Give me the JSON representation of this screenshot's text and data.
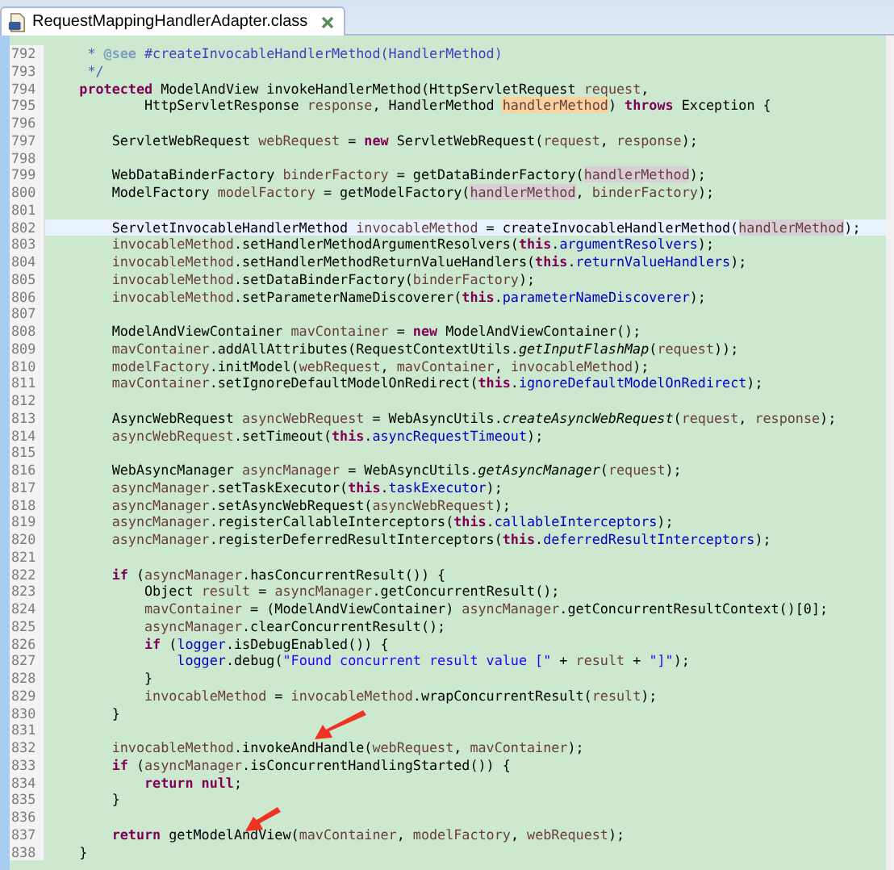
{
  "tab": {
    "title": "RequestMappingHandlerAdapter.class",
    "selected": true
  },
  "lines": [
    {
      "number": "792",
      "current": false,
      "tokens": [
        {
          "kind": "comment",
          "text": "     * "
        },
        {
          "kind": "doc-tag",
          "text": "@see"
        },
        {
          "kind": "doc-link",
          "text": " #createInvocableHandlerMethod(HandlerMethod)"
        }
      ]
    },
    {
      "number": "793",
      "current": false,
      "tokens": [
        {
          "kind": "comment",
          "text": "     */"
        }
      ]
    },
    {
      "number": "794",
      "current": false,
      "tokens": [
        {
          "kind": "keyword",
          "text": "    protected"
        },
        {
          "kind": "plain",
          "text": " ModelAndView invokeHandlerMethod(HttpServletRequest "
        },
        {
          "kind": "local",
          "text": "request"
        },
        {
          "kind": "plain",
          "text": ","
        }
      ]
    },
    {
      "number": "795",
      "current": false,
      "tokens": [
        {
          "kind": "plain",
          "text": "            HttpServletResponse "
        },
        {
          "kind": "local",
          "text": "response"
        },
        {
          "kind": "plain",
          "text": ", HandlerMethod "
        },
        {
          "kind": "occurrence-write",
          "text": "handlerMethod"
        },
        {
          "kind": "plain",
          "text": ") "
        },
        {
          "kind": "keyword",
          "text": "throws"
        },
        {
          "kind": "plain",
          "text": " Exception {"
        }
      ]
    },
    {
      "number": "796",
      "current": false
    },
    {
      "number": "797",
      "current": false,
      "tokens": [
        {
          "kind": "plain",
          "text": "        ServletWebRequest "
        },
        {
          "kind": "local",
          "text": "webRequest"
        },
        {
          "kind": "plain",
          "text": " = "
        },
        {
          "kind": "keyword",
          "text": "new"
        },
        {
          "kind": "plain",
          "text": " ServletWebRequest("
        },
        {
          "kind": "local",
          "text": "request"
        },
        {
          "kind": "plain",
          "text": ", "
        },
        {
          "kind": "local",
          "text": "response"
        },
        {
          "kind": "plain",
          "text": ");"
        }
      ]
    },
    {
      "number": "798",
      "current": false
    },
    {
      "number": "799",
      "current": false,
      "tokens": [
        {
          "kind": "plain",
          "text": "        WebDataBinderFactory "
        },
        {
          "kind": "local",
          "text": "binderFactory"
        },
        {
          "kind": "plain",
          "text": " = getDataBinderFactory("
        },
        {
          "kind": "occurrence-read",
          "text": "handlerMethod"
        },
        {
          "kind": "plain",
          "text": ");"
        }
      ]
    },
    {
      "number": "800",
      "current": false,
      "tokens": [
        {
          "kind": "plain",
          "text": "        ModelFactory "
        },
        {
          "kind": "local",
          "text": "modelFactory"
        },
        {
          "kind": "plain",
          "text": " = getModelFactory("
        },
        {
          "kind": "occurrence-read",
          "text": "handlerMethod"
        },
        {
          "kind": "plain",
          "text": ", "
        },
        {
          "kind": "local",
          "text": "binderFactory"
        },
        {
          "kind": "plain",
          "text": ");"
        }
      ]
    },
    {
      "number": "801",
      "current": false
    },
    {
      "number": "802",
      "current": true,
      "tokens": [
        {
          "kind": "plain",
          "text": "        ServletInvocableHandlerMethod "
        },
        {
          "kind": "local",
          "text": "invocableMethod"
        },
        {
          "kind": "plain",
          "text": " = createInvocableHandlerMethod("
        },
        {
          "kind": "occurrence-read",
          "text": "handlerMethod"
        },
        {
          "kind": "plain",
          "text": ");"
        }
      ]
    },
    {
      "number": "803",
      "current": false,
      "tokens": [
        {
          "kind": "local",
          "text": "        invocableMethod"
        },
        {
          "kind": "plain",
          "text": ".setHandlerMethodArgumentResolvers("
        },
        {
          "kind": "keyword",
          "text": "this"
        },
        {
          "kind": "plain",
          "text": "."
        },
        {
          "kind": "field",
          "text": "argumentResolvers"
        },
        {
          "kind": "plain",
          "text": ");"
        }
      ]
    },
    {
      "number": "804",
      "current": false,
      "tokens": [
        {
          "kind": "local",
          "text": "        invocableMethod"
        },
        {
          "kind": "plain",
          "text": ".setHandlerMethodReturnValueHandlers("
        },
        {
          "kind": "keyword",
          "text": "this"
        },
        {
          "kind": "plain",
          "text": "."
        },
        {
          "kind": "field",
          "text": "returnValueHandlers"
        },
        {
          "kind": "plain",
          "text": ");"
        }
      ]
    },
    {
      "number": "805",
      "current": false,
      "tokens": [
        {
          "kind": "local",
          "text": "        invocableMethod"
        },
        {
          "kind": "plain",
          "text": ".setDataBinderFactory("
        },
        {
          "kind": "local",
          "text": "binderFactory"
        },
        {
          "kind": "plain",
          "text": ");"
        }
      ]
    },
    {
      "number": "806",
      "current": false,
      "tokens": [
        {
          "kind": "local",
          "text": "        invocableMethod"
        },
        {
          "kind": "plain",
          "text": ".setParameterNameDiscoverer("
        },
        {
          "kind": "keyword",
          "text": "this"
        },
        {
          "kind": "plain",
          "text": "."
        },
        {
          "kind": "field",
          "text": "parameterNameDiscoverer"
        },
        {
          "kind": "plain",
          "text": ");"
        }
      ]
    },
    {
      "number": "807",
      "current": false
    },
    {
      "number": "808",
      "current": false,
      "tokens": [
        {
          "kind": "plain",
          "text": "        ModelAndViewContainer "
        },
        {
          "kind": "local",
          "text": "mavContainer"
        },
        {
          "kind": "plain",
          "text": " = "
        },
        {
          "kind": "keyword",
          "text": "new"
        },
        {
          "kind": "plain",
          "text": " ModelAndViewContainer();"
        }
      ]
    },
    {
      "number": "809",
      "current": false,
      "tokens": [
        {
          "kind": "local",
          "text": "        mavContainer"
        },
        {
          "kind": "plain",
          "text": ".addAllAttributes(RequestContextUtils."
        },
        {
          "kind": "static",
          "text": "getInputFlashMap"
        },
        {
          "kind": "plain",
          "text": "("
        },
        {
          "kind": "local",
          "text": "request"
        },
        {
          "kind": "plain",
          "text": "));"
        }
      ]
    },
    {
      "number": "810",
      "current": false,
      "tokens": [
        {
          "kind": "local",
          "text": "        modelFactory"
        },
        {
          "kind": "plain",
          "text": ".initModel("
        },
        {
          "kind": "local",
          "text": "webRequest"
        },
        {
          "kind": "plain",
          "text": ", "
        },
        {
          "kind": "local",
          "text": "mavContainer"
        },
        {
          "kind": "plain",
          "text": ", "
        },
        {
          "kind": "local",
          "text": "invocableMethod"
        },
        {
          "kind": "plain",
          "text": ");"
        }
      ]
    },
    {
      "number": "811",
      "current": false,
      "tokens": [
        {
          "kind": "local",
          "text": "        mavContainer"
        },
        {
          "kind": "plain",
          "text": ".setIgnoreDefaultModelOnRedirect("
        },
        {
          "kind": "keyword",
          "text": "this"
        },
        {
          "kind": "plain",
          "text": "."
        },
        {
          "kind": "field",
          "text": "ignoreDefaultModelOnRedirect"
        },
        {
          "kind": "plain",
          "text": ");"
        }
      ]
    },
    {
      "number": "812",
      "current": false
    },
    {
      "number": "813",
      "current": false,
      "tokens": [
        {
          "kind": "plain",
          "text": "        AsyncWebRequest "
        },
        {
          "kind": "local",
          "text": "asyncWebRequest"
        },
        {
          "kind": "plain",
          "text": " = WebAsyncUtils."
        },
        {
          "kind": "static",
          "text": "createAsyncWebRequest"
        },
        {
          "kind": "plain",
          "text": "("
        },
        {
          "kind": "local",
          "text": "request"
        },
        {
          "kind": "plain",
          "text": ", "
        },
        {
          "kind": "local",
          "text": "response"
        },
        {
          "kind": "plain",
          "text": ");"
        }
      ]
    },
    {
      "number": "814",
      "current": false,
      "tokens": [
        {
          "kind": "local",
          "text": "        asyncWebRequest"
        },
        {
          "kind": "plain",
          "text": ".setTimeout("
        },
        {
          "kind": "keyword",
          "text": "this"
        },
        {
          "kind": "plain",
          "text": "."
        },
        {
          "kind": "field",
          "text": "asyncRequestTimeout"
        },
        {
          "kind": "plain",
          "text": ");"
        }
      ]
    },
    {
      "number": "815",
      "current": false
    },
    {
      "number": "816",
      "current": false,
      "tokens": [
        {
          "kind": "plain",
          "text": "        WebAsyncManager "
        },
        {
          "kind": "local",
          "text": "asyncManager"
        },
        {
          "kind": "plain",
          "text": " = WebAsyncUtils."
        },
        {
          "kind": "static",
          "text": "getAsyncManager"
        },
        {
          "kind": "plain",
          "text": "("
        },
        {
          "kind": "local",
          "text": "request"
        },
        {
          "kind": "plain",
          "text": ");"
        }
      ]
    },
    {
      "number": "817",
      "current": false,
      "tokens": [
        {
          "kind": "local",
          "text": "        asyncManager"
        },
        {
          "kind": "plain",
          "text": ".setTaskExecutor("
        },
        {
          "kind": "keyword",
          "text": "this"
        },
        {
          "kind": "plain",
          "text": "."
        },
        {
          "kind": "field",
          "text": "taskExecutor"
        },
        {
          "kind": "plain",
          "text": ");"
        }
      ]
    },
    {
      "number": "818",
      "current": false,
      "tokens": [
        {
          "kind": "local",
          "text": "        asyncManager"
        },
        {
          "kind": "plain",
          "text": ".setAsyncWebRequest("
        },
        {
          "kind": "local",
          "text": "asyncWebRequest"
        },
        {
          "kind": "plain",
          "text": ");"
        }
      ]
    },
    {
      "number": "819",
      "current": false,
      "tokens": [
        {
          "kind": "local",
          "text": "        asyncManager"
        },
        {
          "kind": "plain",
          "text": ".registerCallableInterceptors("
        },
        {
          "kind": "keyword",
          "text": "this"
        },
        {
          "kind": "plain",
          "text": "."
        },
        {
          "kind": "field",
          "text": "callableInterceptors"
        },
        {
          "kind": "plain",
          "text": ");"
        }
      ]
    },
    {
      "number": "820",
      "current": false,
      "tokens": [
        {
          "kind": "local",
          "text": "        asyncManager"
        },
        {
          "kind": "plain",
          "text": ".registerDeferredResultInterceptors("
        },
        {
          "kind": "keyword",
          "text": "this"
        },
        {
          "kind": "plain",
          "text": "."
        },
        {
          "kind": "field",
          "text": "deferredResultInterceptors"
        },
        {
          "kind": "plain",
          "text": ");"
        }
      ]
    },
    {
      "number": "821",
      "current": false
    },
    {
      "number": "822",
      "current": false,
      "tokens": [
        {
          "kind": "keyword",
          "text": "        if"
        },
        {
          "kind": "plain",
          "text": " ("
        },
        {
          "kind": "local",
          "text": "asyncManager"
        },
        {
          "kind": "plain",
          "text": ".hasConcurrentResult()) {"
        }
      ]
    },
    {
      "number": "823",
      "current": false,
      "tokens": [
        {
          "kind": "plain",
          "text": "            Object "
        },
        {
          "kind": "local",
          "text": "result"
        },
        {
          "kind": "plain",
          "text": " = "
        },
        {
          "kind": "local",
          "text": "asyncManager"
        },
        {
          "kind": "plain",
          "text": ".getConcurrentResult();"
        }
      ]
    },
    {
      "number": "824",
      "current": false,
      "tokens": [
        {
          "kind": "local",
          "text": "            mavContainer"
        },
        {
          "kind": "plain",
          "text": " = (ModelAndViewContainer) "
        },
        {
          "kind": "local",
          "text": "asyncManager"
        },
        {
          "kind": "plain",
          "text": ".getConcurrentResultContext()[0];"
        }
      ]
    },
    {
      "number": "825",
      "current": false,
      "tokens": [
        {
          "kind": "local",
          "text": "            asyncManager"
        },
        {
          "kind": "plain",
          "text": ".clearConcurrentResult();"
        }
      ]
    },
    {
      "number": "826",
      "current": false,
      "tokens": [
        {
          "kind": "keyword",
          "text": "            if"
        },
        {
          "kind": "plain",
          "text": " ("
        },
        {
          "kind": "field",
          "text": "logger"
        },
        {
          "kind": "plain",
          "text": ".isDebugEnabled()) {"
        }
      ]
    },
    {
      "number": "827",
      "current": false,
      "tokens": [
        {
          "kind": "field",
          "text": "                logger"
        },
        {
          "kind": "plain",
          "text": ".debug("
        },
        {
          "kind": "string",
          "text": "\"Found concurrent result value [\""
        },
        {
          "kind": "plain",
          "text": " + "
        },
        {
          "kind": "local",
          "text": "result"
        },
        {
          "kind": "plain",
          "text": " + "
        },
        {
          "kind": "string",
          "text": "\"]\""
        },
        {
          "kind": "plain",
          "text": ");"
        }
      ]
    },
    {
      "number": "828",
      "current": false,
      "tokens": [
        {
          "kind": "plain",
          "text": "            }"
        }
      ]
    },
    {
      "number": "829",
      "current": false,
      "tokens": [
        {
          "kind": "local",
          "text": "            invocableMethod"
        },
        {
          "kind": "plain",
          "text": " = "
        },
        {
          "kind": "local",
          "text": "invocableMethod"
        },
        {
          "kind": "plain",
          "text": ".wrapConcurrentResult("
        },
        {
          "kind": "local",
          "text": "result"
        },
        {
          "kind": "plain",
          "text": ");"
        }
      ]
    },
    {
      "number": "830",
      "current": false,
      "tokens": [
        {
          "kind": "plain",
          "text": "        }"
        }
      ]
    },
    {
      "number": "831",
      "current": false
    },
    {
      "number": "832",
      "current": false,
      "tokens": [
        {
          "kind": "local",
          "text": "        invocableMethod"
        },
        {
          "kind": "plain",
          "text": ".invokeAndHandle("
        },
        {
          "kind": "local",
          "text": "webRequest"
        },
        {
          "kind": "plain",
          "text": ", "
        },
        {
          "kind": "local",
          "text": "mavContainer"
        },
        {
          "kind": "plain",
          "text": ");"
        }
      ]
    },
    {
      "number": "833",
      "current": false,
      "tokens": [
        {
          "kind": "keyword",
          "text": "        if"
        },
        {
          "kind": "plain",
          "text": " ("
        },
        {
          "kind": "local",
          "text": "asyncManager"
        },
        {
          "kind": "plain",
          "text": ".isConcurrentHandlingStarted()) {"
        }
      ]
    },
    {
      "number": "834",
      "current": false,
      "tokens": [
        {
          "kind": "keyword",
          "text": "            return null"
        },
        {
          "kind": "plain",
          "text": ";"
        }
      ]
    },
    {
      "number": "835",
      "current": false,
      "tokens": [
        {
          "kind": "plain",
          "text": "        }"
        }
      ]
    },
    {
      "number": "836",
      "current": false
    },
    {
      "number": "837",
      "current": false,
      "tokens": [
        {
          "kind": "keyword",
          "text": "        return"
        },
        {
          "kind": "plain",
          "text": " getModelAndView("
        },
        {
          "kind": "local",
          "text": "mavContainer"
        },
        {
          "kind": "plain",
          "text": ", "
        },
        {
          "kind": "local",
          "text": "modelFactory"
        },
        {
          "kind": "plain",
          "text": ", "
        },
        {
          "kind": "local",
          "text": "webRequest"
        },
        {
          "kind": "plain",
          "text": ");"
        }
      ]
    },
    {
      "number": "838",
      "current": false,
      "tokens": [
        {
          "kind": "plain",
          "text": "    }"
        }
      ]
    }
  ]
}
